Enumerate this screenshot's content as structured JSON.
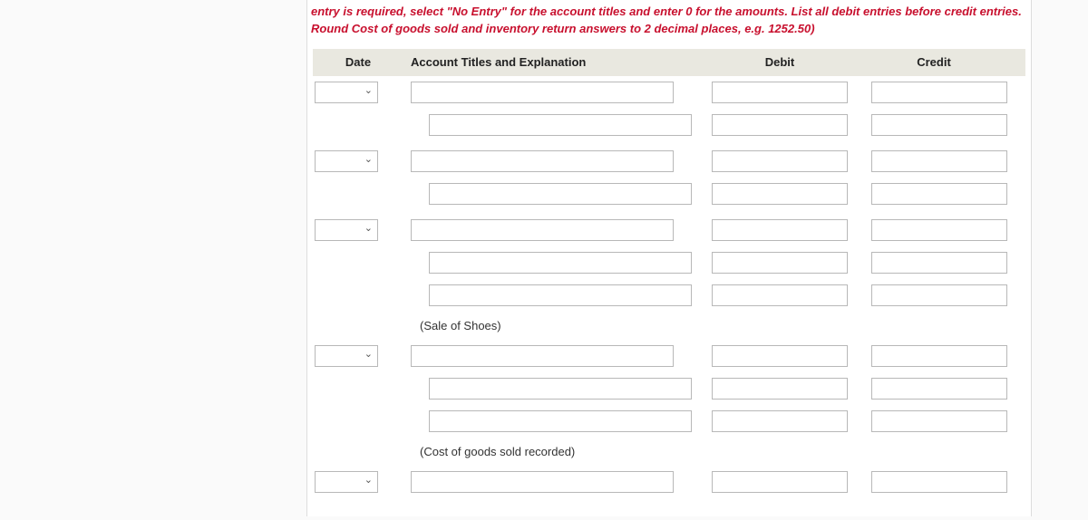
{
  "instruction": "entry is required, select \"No Entry\" for the account titles and enter 0 for the amounts. List all debit entries before credit entries. Round Cost of goods sold and inventory return answers to 2 decimal places, e.g. 1252.50)",
  "headers": {
    "date": "Date",
    "account": "Account Titles and Explanation",
    "debit": "Debit",
    "credit": "Credit"
  },
  "notes": {
    "sale": "(Sale of Shoes)",
    "cogs": "(Cost of goods sold recorded)"
  }
}
